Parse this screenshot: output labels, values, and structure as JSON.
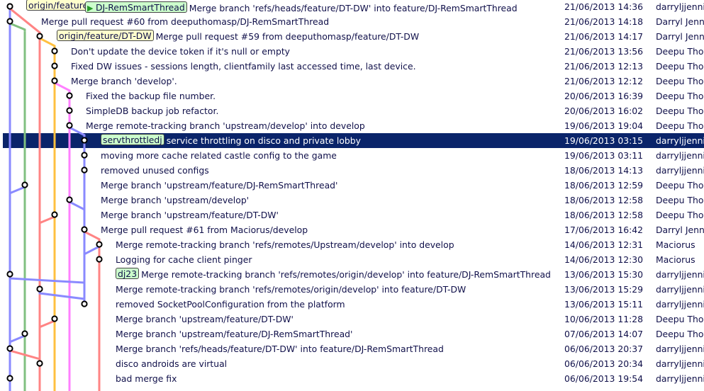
{
  "colors": {
    "lane_blue": "#8a8aff",
    "lane_green": "#80c080",
    "lane_red": "#ff8484",
    "lane_yellow": "#ffc040",
    "lane_magenta": "#ff80ff",
    "selected_bg": "#0a246a",
    "remote_tag": "#ffffcc",
    "local_tag": "#ccffcc"
  },
  "commits": [
    {
      "lane": 0,
      "tags": [
        {
          "label": "origin/feature",
          "kind": "remote",
          "clip": true
        },
        {
          "label": "DJ-RemSmartThread",
          "kind": "local",
          "head": true
        }
      ],
      "message": "Merge branch 'refs/heads/feature/DT-DW' into feature/DJ-RemSmartThread",
      "date": "21/06/2013 14:36",
      "author": "darryljjenni"
    },
    {
      "lane": 0,
      "message": "Merge pull request #60 from deeputhomasp/DJ-RemSmartThread",
      "date": "21/06/2013 14:18",
      "author": "Darryl Jenn"
    },
    {
      "lane": 2,
      "tags": [
        {
          "label": "origin/feature/DT-DW",
          "kind": "remote"
        }
      ],
      "message": "Merge pull request #59 from deeputhomasp/feature/DT-DW",
      "date": "21/06/2013 14:17",
      "author": "Darryl Jenn"
    },
    {
      "lane": 3,
      "message": "Don't update the device token if it's null or empty",
      "date": "21/06/2013 13:56",
      "author": "Deepu Tho"
    },
    {
      "lane": 3,
      "message": "Fixed DW issues - sessions length, clientfamily last accessed time, last device.",
      "date": "21/06/2013 12:13",
      "author": "Deepu Tho"
    },
    {
      "lane": 3,
      "message": "Merge branch 'develop'.",
      "date": "21/06/2013 12:12",
      "author": "Deepu Tho"
    },
    {
      "lane": 4,
      "message": "Fixed the backup file number.",
      "date": "20/06/2013 16:39",
      "author": "Deepu Tho"
    },
    {
      "lane": 4,
      "message": "SimpleDB backup job refactor.",
      "date": "20/06/2013 16:02",
      "author": "Deepu Tho"
    },
    {
      "lane": 4,
      "message": "Merge remote-tracking branch 'upstream/develop' into develop",
      "date": "19/06/2013 19:04",
      "author": "Deepu Tho"
    },
    {
      "lane": 5,
      "selected": true,
      "tags": [
        {
          "label": "servthrottledj",
          "kind": "local"
        }
      ],
      "message": "service throttling on disco and private lobby",
      "date": "19/06/2013 03:15",
      "author": "darryljjenni"
    },
    {
      "lane": 5,
      "message": "moving more cache related castle config to the game",
      "date": "19/06/2013 03:11",
      "author": "darryljjenni"
    },
    {
      "lane": 5,
      "message": "removed unused configs",
      "date": "18/06/2013 14:13",
      "author": "darryljjenni"
    },
    {
      "lane": 1,
      "message": "Merge branch 'upstream/feature/DJ-RemSmartThread'",
      "date": "18/06/2013 12:59",
      "author": "Deepu Tho"
    },
    {
      "lane": 4,
      "message": "Merge branch 'upstream/develop'",
      "date": "18/06/2013 12:58",
      "author": "Deepu Tho"
    },
    {
      "lane": 3,
      "message": "Merge branch 'upstream/feature/DT-DW'",
      "date": "18/06/2013 12:58",
      "author": "Deepu Tho"
    },
    {
      "lane": 5,
      "message": "Merge pull request #61 from Maciorus/develop",
      "date": "17/06/2013 16:42",
      "author": "Darryl Jenn"
    },
    {
      "lane": 6,
      "message": "Merge remote-tracking branch 'refs/remotes/Upstream/develop' into develop",
      "date": "14/06/2013 12:31",
      "author": "Maciorus"
    },
    {
      "lane": 6,
      "message": "Logging for cache client pinger",
      "date": "14/06/2013 12:30",
      "author": "Maciorus"
    },
    {
      "lane": 0,
      "tags": [
        {
          "label": "dj23",
          "kind": "local"
        }
      ],
      "message": "Merge remote-tracking branch 'refs/remotes/origin/develop' into feature/DJ-RemSmartThread",
      "date": "13/06/2013 15:30",
      "author": "darryljjenni"
    },
    {
      "lane": 2,
      "message": "Merge remote-tracking branch 'refs/remotes/origin/develop' into feature/DT-DW",
      "date": "13/06/2013 15:29",
      "author": "darryljjenni"
    },
    {
      "lane": 5,
      "message": "removed SocketPoolConfiguration from the platform",
      "date": "13/06/2013 15:11",
      "author": "darryljjenni"
    },
    {
      "lane": 3,
      "message": "Merge branch 'upstream/feature/DT-DW'",
      "date": "10/06/2013 11:28",
      "author": "Deepu Tho"
    },
    {
      "lane": 1,
      "message": "Merge branch 'upstream/feature/DJ-RemSmartThread'",
      "date": "07/06/2013 14:07",
      "author": "Deepu Tho"
    },
    {
      "lane": 0,
      "message": "Merge branch 'refs/heads/feature/DT-DW' into feature/DJ-RemSmartThread",
      "date": "06/06/2013 20:37",
      "author": "darryljjenni"
    },
    {
      "lane": 2,
      "message": "disco androids are virtual",
      "date": "06/06/2013 20:34",
      "author": "darryljjenni"
    },
    {
      "lane": 0,
      "message": "bad merge fix",
      "date": "06/06/2013 19:54",
      "author": "darryljjenni"
    }
  ]
}
